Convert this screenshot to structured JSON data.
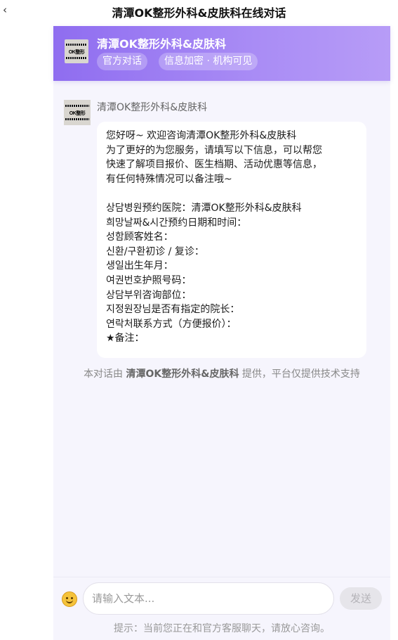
{
  "topbar": {
    "back_icon": "chevron-left-icon",
    "back_glyph": "‹",
    "title": "清潭OK整形外科&皮肤科在线对话"
  },
  "header": {
    "logo_text": "OK整形",
    "name": "清潭OK整形外科&皮肤科",
    "tags": [
      "官方对话",
      "信息加密 · 机构可见"
    ],
    "gradient_colors": [
      "#8f6df0",
      "#b79cf7"
    ]
  },
  "message": {
    "sender": "清潭OK整形外科&皮肤科",
    "avatar_text": "OK整形",
    "lines": [
      "您好呀~ 欢迎咨询清潭OK整形外科&皮肤科",
      "为了更好的为您服务，请填写以下信息，可以帮您",
      "快速了解项目报价、医生档期、活动优惠等信息，",
      "有任何特殊情况可以备注哦~",
      "",
      "상담병원预约医院：清潭OK整形外科&皮肤科",
      "희망날짜&시간预约日期和时间：",
      "성함顾客姓名：",
      "신환/구환初诊 / 复诊：",
      "생일出生年月：",
      "여권번호护照号码：",
      "상담부위咨询部位：",
      "지정원장님是否有指定的院长：",
      "연락처联系方式（方便报价）：",
      "★备注："
    ]
  },
  "provider_note": {
    "prefix": "本对话由 ",
    "org": "清潭OK整形外科&皮肤科",
    "suffix": " 提供，平台仅提供技术支持"
  },
  "input_bar": {
    "emoji_icon": "smiley-face-icon",
    "placeholder": "请输入文本...",
    "value": "",
    "send_label": "发送",
    "hint": "提示：当前您正在和官方客服聊天，请放心咨询。"
  }
}
